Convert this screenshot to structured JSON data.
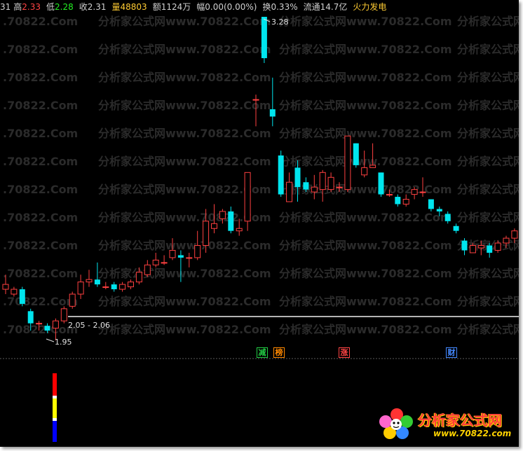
{
  "info_bar": {
    "open_value": "31",
    "high_label": "高",
    "high_value": "2.33",
    "low_label": "低",
    "low_value": "2.28",
    "close_label": "收",
    "close_value": "2.31",
    "volume_label": "量",
    "volume_value": "48803",
    "amount_label": "额",
    "amount_value": "1124万",
    "change_label": "幅",
    "change_value": "0.00(0.00%)",
    "turnover_label": "换",
    "turnover_value": "0.33%",
    "float_label": "流通",
    "float_value": "14.7亿",
    "stock_name": "火力发电"
  },
  "annotations": {
    "peak_label": "3.28",
    "low_label": "1.95",
    "range_label": "2.05 - 2.06"
  },
  "watermark": {
    "cn": "分析家公式网",
    "url": "www.70822.Com",
    "url_left": ".70822.Com"
  },
  "event_tags": [
    {
      "text": "减",
      "color": "#22cc44"
    },
    {
      "text": "榜",
      "color": "#ff8800"
    },
    {
      "text": "涨",
      "color": "#ff4444"
    },
    {
      "text": "财",
      "color": "#4488ff"
    }
  ],
  "logo": {
    "text": "分析家公式网",
    "url": "www.70822.com"
  },
  "colors": {
    "up": "#ff4040",
    "down": "#00e5ee",
    "support_line": "#b4b4b4"
  },
  "chart_data": {
    "type": "candlestick",
    "y_high": 3.28,
    "y_low": 1.95,
    "support_range": [
      2.05,
      2.06
    ],
    "candles": [
      {
        "o": 2.16,
        "c": 2.18,
        "h": 2.22,
        "l": 2.14
      },
      {
        "o": 2.14,
        "c": 2.16,
        "h": 2.17,
        "l": 2.13
      },
      {
        "o": 2.16,
        "c": 2.1,
        "h": 2.17,
        "l": 2.09
      },
      {
        "o": 2.07,
        "c": 2.02,
        "h": 2.08,
        "l": 1.99
      },
      {
        "o": 2.02,
        "c": 2.02,
        "h": 2.03,
        "l": 1.99
      },
      {
        "o": 2.01,
        "c": 1.99,
        "h": 2.02,
        "l": 1.98
      },
      {
        "o": 2.0,
        "c": 2.03,
        "h": 2.04,
        "l": 1.95
      },
      {
        "o": 2.03,
        "c": 2.08,
        "h": 2.09,
        "l": 2.02
      },
      {
        "o": 2.09,
        "c": 2.14,
        "h": 2.15,
        "l": 2.08
      },
      {
        "o": 2.14,
        "c": 2.19,
        "h": 2.22,
        "l": 2.12
      },
      {
        "o": 2.19,
        "c": 2.2,
        "h": 2.24,
        "l": 2.17
      },
      {
        "o": 2.2,
        "c": 2.18,
        "h": 2.27,
        "l": 2.17
      },
      {
        "o": 2.17,
        "c": 2.17,
        "h": 2.19,
        "l": 2.16
      },
      {
        "o": 2.18,
        "c": 2.16,
        "h": 2.19,
        "l": 2.15
      },
      {
        "o": 2.16,
        "c": 2.18,
        "h": 2.19,
        "l": 2.15
      },
      {
        "o": 2.17,
        "c": 2.19,
        "h": 2.2,
        "l": 2.16
      },
      {
        "o": 2.19,
        "c": 2.23,
        "h": 2.25,
        "l": 2.18
      },
      {
        "o": 2.22,
        "c": 2.26,
        "h": 2.28,
        "l": 2.21
      },
      {
        "o": 2.26,
        "c": 2.28,
        "h": 2.31,
        "l": 2.25
      },
      {
        "o": 2.27,
        "c": 2.27,
        "h": 2.3,
        "l": 2.26
      },
      {
        "o": 2.29,
        "c": 2.32,
        "h": 2.37,
        "l": 2.28
      },
      {
        "o": 2.3,
        "c": 2.29,
        "h": 2.32,
        "l": 2.19
      },
      {
        "o": 2.29,
        "c": 2.29,
        "h": 2.31,
        "l": 2.25
      },
      {
        "o": 2.29,
        "c": 2.34,
        "h": 2.4,
        "l": 2.28
      },
      {
        "o": 2.34,
        "c": 2.44,
        "h": 2.49,
        "l": 2.31
      },
      {
        "o": 2.41,
        "c": 2.43,
        "h": 2.51,
        "l": 2.39
      },
      {
        "o": 2.45,
        "c": 2.48,
        "h": 2.49,
        "l": 2.43
      },
      {
        "o": 2.48,
        "c": 2.4,
        "h": 2.5,
        "l": 2.39
      },
      {
        "o": 2.4,
        "c": 2.41,
        "h": 2.45,
        "l": 2.38
      },
      {
        "o": 2.44,
        "c": 2.64,
        "h": 2.64,
        "l": 2.4
      },
      {
        "o": 2.94,
        "c": 2.94,
        "h": 2.96,
        "l": 2.83
      },
      {
        "o": 3.28,
        "c": 3.11,
        "h": 3.28,
        "l": 3.09
      },
      {
        "o": 2.9,
        "c": 2.87,
        "h": 3.03,
        "l": 2.83
      },
      {
        "o": 2.71,
        "c": 2.55,
        "h": 2.73,
        "l": 2.54
      },
      {
        "o": 2.52,
        "c": 2.6,
        "h": 2.64,
        "l": 2.52
      },
      {
        "o": 2.66,
        "c": 2.58,
        "h": 2.69,
        "l": 2.52
      },
      {
        "o": 2.6,
        "c": 2.57,
        "h": 2.62,
        "l": 2.56
      },
      {
        "o": 2.56,
        "c": 2.58,
        "h": 2.63,
        "l": 2.53
      },
      {
        "o": 2.57,
        "c": 2.64,
        "h": 2.65,
        "l": 2.52
      },
      {
        "o": 2.57,
        "c": 2.62,
        "h": 2.64,
        "l": 2.56
      },
      {
        "o": 2.58,
        "c": 2.58,
        "h": 2.6,
        "l": 2.56
      },
      {
        "o": 2.57,
        "c": 2.79,
        "h": 2.79,
        "l": 2.56
      },
      {
        "o": 2.76,
        "c": 2.67,
        "h": 2.76,
        "l": 2.66
      },
      {
        "o": 2.63,
        "c": 2.66,
        "h": 2.73,
        "l": 2.62
      },
      {
        "o": 2.66,
        "c": 2.67,
        "h": 2.76,
        "l": 2.66
      },
      {
        "o": 2.64,
        "c": 2.55,
        "h": 2.64,
        "l": 2.54
      },
      {
        "o": 2.55,
        "c": 2.55,
        "h": 2.57,
        "l": 2.54
      },
      {
        "o": 2.54,
        "c": 2.51,
        "h": 2.55,
        "l": 2.5
      },
      {
        "o": 2.51,
        "c": 2.53,
        "h": 2.55,
        "l": 2.5
      },
      {
        "o": 2.55,
        "c": 2.57,
        "h": 2.58,
        "l": 2.53
      },
      {
        "o": 2.56,
        "c": 2.56,
        "h": 2.62,
        "l": 2.54
      },
      {
        "o": 2.53,
        "c": 2.49,
        "h": 2.53,
        "l": 2.48
      },
      {
        "o": 2.49,
        "c": 2.48,
        "h": 2.5,
        "l": 2.46
      },
      {
        "o": 2.47,
        "c": 2.44,
        "h": 2.48,
        "l": 2.43
      },
      {
        "o": 2.42,
        "c": 2.4,
        "h": 2.43,
        "l": 2.39
      },
      {
        "o": 2.36,
        "c": 2.32,
        "h": 2.37,
        "l": 2.3
      },
      {
        "o": 2.31,
        "c": 2.34,
        "h": 2.35,
        "l": 2.31
      },
      {
        "o": 2.33,
        "c": 2.34,
        "h": 2.36,
        "l": 2.3
      },
      {
        "o": 2.34,
        "c": 2.31,
        "h": 2.35,
        "l": 2.29
      },
      {
        "o": 2.32,
        "c": 2.35,
        "h": 2.36,
        "l": 2.31
      },
      {
        "o": 2.35,
        "c": 2.37,
        "h": 2.38,
        "l": 2.33
      },
      {
        "o": 2.37,
        "c": 2.4,
        "h": 2.41,
        "l": 2.35
      },
      {
        "o": 2.39,
        "c": 2.42,
        "h": 2.43,
        "l": 2.38
      }
    ]
  }
}
